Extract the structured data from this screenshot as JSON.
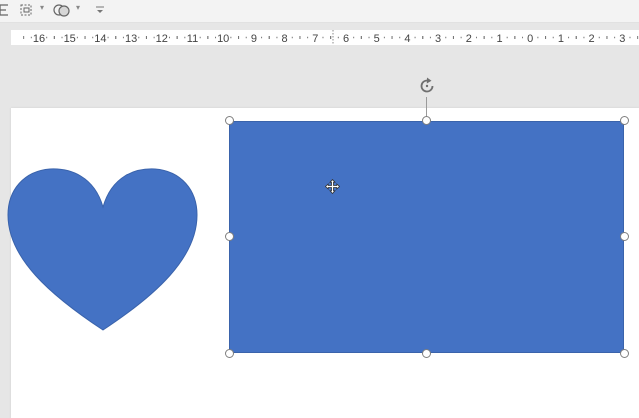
{
  "toolbar": {
    "icons": [
      "align-icon",
      "group-icon",
      "merge-shapes-icon",
      "customize-toolbar-icon"
    ]
  },
  "ruler": {
    "labels": [
      "16",
      "15",
      "14",
      "13",
      "12",
      "11",
      "10",
      "9",
      "8",
      "7",
      "6",
      "5",
      "4",
      "3",
      "2",
      "1",
      "0",
      "1",
      "2",
      "3"
    ]
  },
  "slide": {
    "shapes": [
      "heart",
      "rectangle"
    ],
    "fill_color": "#4472c4",
    "selected_shape": "rectangle"
  }
}
